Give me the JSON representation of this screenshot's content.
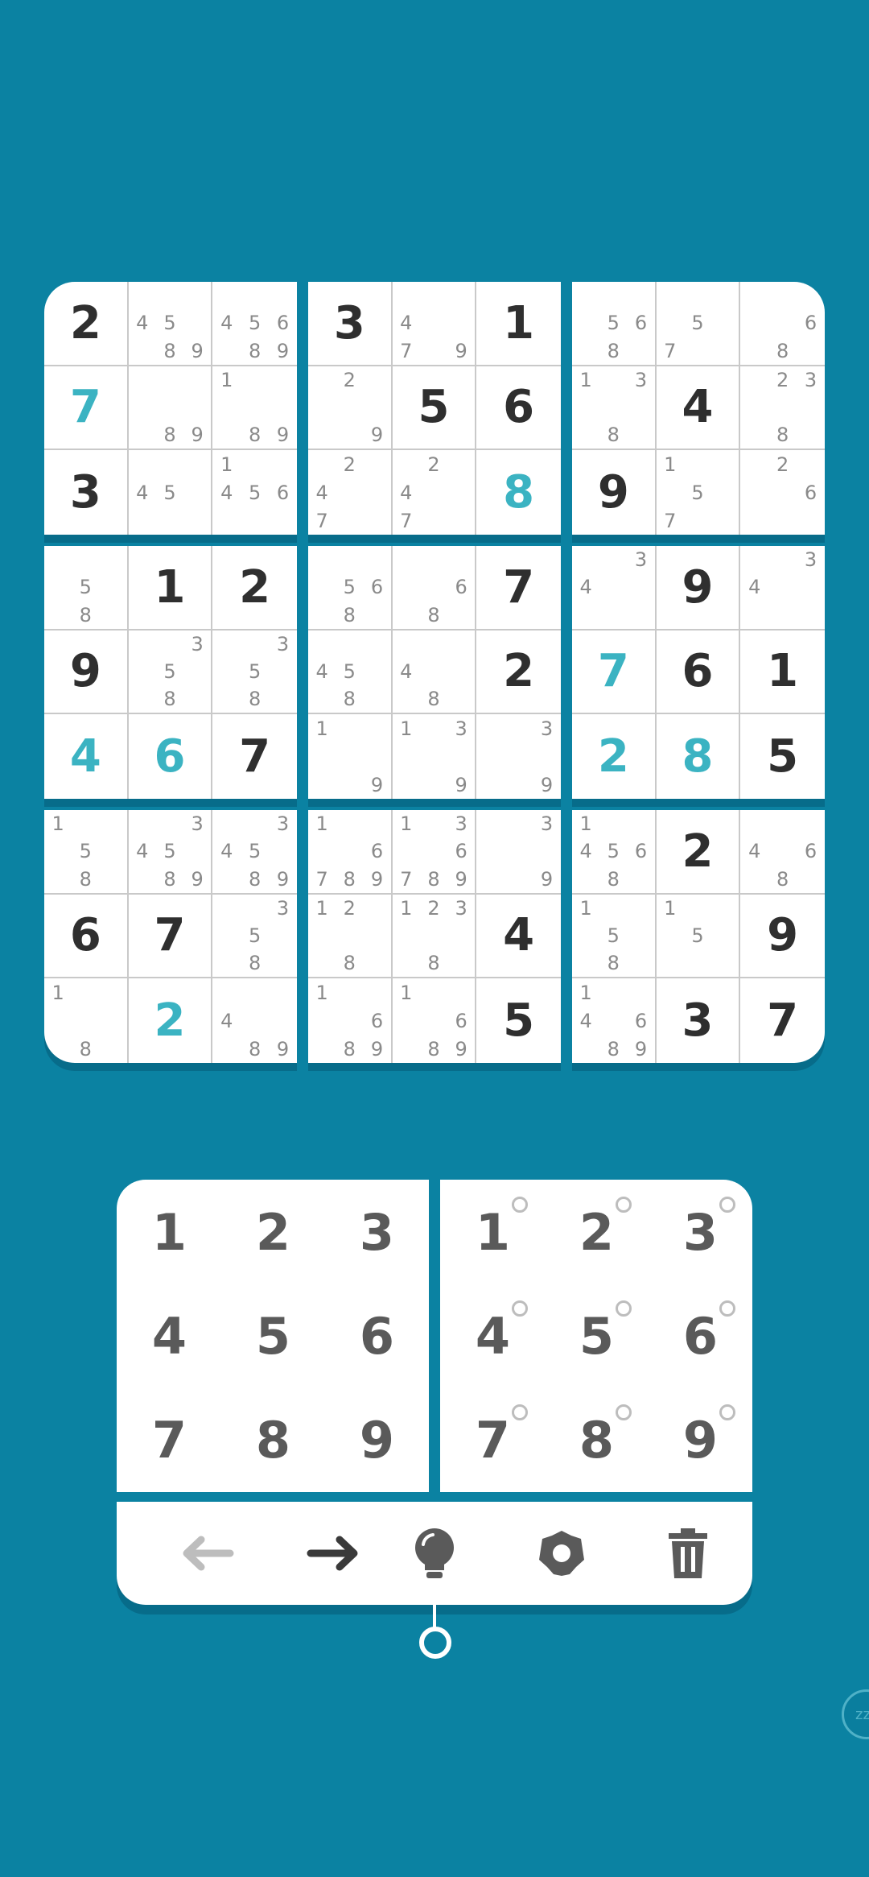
{
  "colors": {
    "background": "#0b82a2",
    "given": "#2f2f2f",
    "user": "#3bb3c2",
    "note": "#8a8a8a",
    "key": "#5a5a5a"
  },
  "board": {
    "rows": [
      [
        "2",
        "4589",
        "45689",
        "3",
        "479",
        "1",
        "568",
        "57",
        "68"
      ],
      [
        "7",
        "89",
        "189",
        "29",
        "5",
        "6",
        "138",
        "4",
        "238"
      ],
      [
        "3",
        "45",
        "1456",
        "247",
        "247",
        "8",
        "9",
        "157",
        "26"
      ],
      [
        "58",
        "1",
        "2",
        "568",
        "68",
        "7",
        "34",
        "9",
        "34"
      ],
      [
        "9",
        "358",
        "358",
        "458",
        "48",
        "2",
        "7",
        "6",
        "1"
      ],
      [
        "4",
        "6",
        "7",
        "19",
        "139",
        "39",
        "2",
        "8",
        "5"
      ],
      [
        "158",
        "34589",
        "34589",
        "16789",
        "136789",
        "39",
        "14568",
        "2",
        "468"
      ],
      [
        "6",
        "7",
        "358",
        "128",
        "1238",
        "4",
        "158",
        "15",
        "9"
      ],
      [
        "18",
        "2",
        "489",
        "1689",
        "1689",
        "5",
        "14689",
        "3",
        "7"
      ]
    ],
    "types": [
      [
        "g",
        "n",
        "n",
        "g",
        "n",
        "g",
        "n",
        "n",
        "n"
      ],
      [
        "u",
        "n",
        "n",
        "n",
        "g",
        "g",
        "n",
        "g",
        "n"
      ],
      [
        "g",
        "n",
        "n",
        "n",
        "n",
        "u",
        "g",
        "n",
        "n"
      ],
      [
        "n",
        "g",
        "g",
        "n",
        "n",
        "g",
        "n",
        "g",
        "n"
      ],
      [
        "g",
        "n",
        "n",
        "n",
        "n",
        "g",
        "u",
        "g",
        "g"
      ],
      [
        "u",
        "u",
        "g",
        "n",
        "n",
        "n",
        "u",
        "u",
        "g"
      ],
      [
        "n",
        "n",
        "n",
        "n",
        "n",
        "n",
        "n",
        "g",
        "n"
      ],
      [
        "g",
        "g",
        "n",
        "n",
        "n",
        "g",
        "n",
        "n",
        "g"
      ],
      [
        "n",
        "u",
        "n",
        "n",
        "n",
        "g",
        "n",
        "g",
        "g"
      ]
    ]
  },
  "number_pad": {
    "keys": [
      "1",
      "2",
      "3",
      "4",
      "5",
      "6",
      "7",
      "8",
      "9"
    ]
  },
  "note_pad": {
    "keys": [
      "1",
      "2",
      "3",
      "4",
      "5",
      "6",
      "7",
      "8",
      "9"
    ]
  },
  "toolbar": {
    "tools": [
      "undo-arrow",
      "redo-arrow",
      "hint-bulb",
      "settings-gear",
      "delete-trash"
    ]
  },
  "sleep_label": "zz"
}
